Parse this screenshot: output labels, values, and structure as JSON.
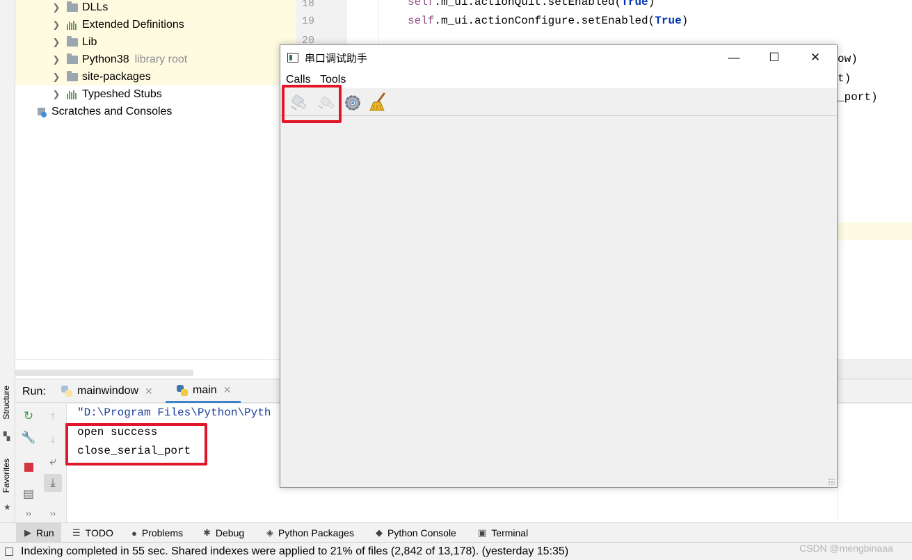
{
  "project_tree": {
    "items": [
      {
        "label": "DLLs",
        "icon": "folder-icon",
        "note": ""
      },
      {
        "label": "Extended Definitions",
        "icon": "library-icon",
        "note": ""
      },
      {
        "label": "Lib",
        "icon": "folder-icon",
        "note": ""
      },
      {
        "label": "Python38",
        "icon": "folder-icon",
        "note": "library root"
      },
      {
        "label": "site-packages",
        "icon": "folder-icon",
        "note": ""
      },
      {
        "label": "Typeshed Stubs",
        "icon": "library-icon",
        "note": ""
      }
    ],
    "scratches_label": "Scratches and Consoles"
  },
  "editor": {
    "line_numbers": [
      "18",
      "19",
      "20"
    ],
    "line18": {
      "self": "self",
      "rest": ".m_ui.actionQuit.setEnabled(",
      "kw": "True",
      "end": ")"
    },
    "line19": {
      "self": "self",
      "rest": ".m_ui.actionConfigure.setEnabled(",
      "kw": "True",
      "end": ")"
    },
    "tail_fragments": [
      "ow)",
      "t)",
      "_port)"
    ]
  },
  "left_strip": {
    "structure_label": "Structure",
    "favorites_label": "Favorites"
  },
  "run_panel": {
    "title": "Run:",
    "tabs": [
      {
        "label": "mainwindow",
        "active": false
      },
      {
        "label": "main",
        "active": true
      }
    ],
    "console_lines": [
      "\"D:\\Program Files\\Python\\Pyth",
      "open success",
      "close_serial_port"
    ]
  },
  "bottom_tabs": [
    {
      "label": "Run",
      "icon": "run-icon",
      "active": true
    },
    {
      "label": "TODO",
      "icon": "todo-icon",
      "active": false
    },
    {
      "label": "Problems",
      "icon": "problems-icon",
      "active": false
    },
    {
      "label": "Debug",
      "icon": "debug-icon",
      "active": false
    },
    {
      "label": "Python Packages",
      "icon": "packages-icon",
      "active": false
    },
    {
      "label": "Python Console",
      "icon": "python-console-icon",
      "active": false
    },
    {
      "label": "Terminal",
      "icon": "terminal-icon",
      "active": false
    }
  ],
  "status_bar": {
    "text": "Indexing completed in 55 sec. Shared indexes were applied to 21% of files (2,842 of 13,178). (yesterday 15:35)",
    "watermark": "CSDN @mengbinaaa"
  },
  "qt_window": {
    "title": "串口调试助手",
    "controls": {
      "minimize": "—",
      "maximize": "☐",
      "close": "✕"
    },
    "menus": [
      "Calls",
      "Tools"
    ],
    "toolbar": [
      {
        "name": "connect-icon",
        "enabled": false
      },
      {
        "name": "disconnect-icon",
        "enabled": false
      },
      {
        "name": "configure-gear-icon",
        "enabled": true
      },
      {
        "name": "clear-broom-icon",
        "enabled": true
      }
    ]
  },
  "colors": {
    "annotation_red": "#e0172b",
    "tree_highlight": "#fefbe1",
    "keyword_self": "#94558d",
    "keyword_true": "#0033b3",
    "console_command": "#1a3f9a"
  }
}
